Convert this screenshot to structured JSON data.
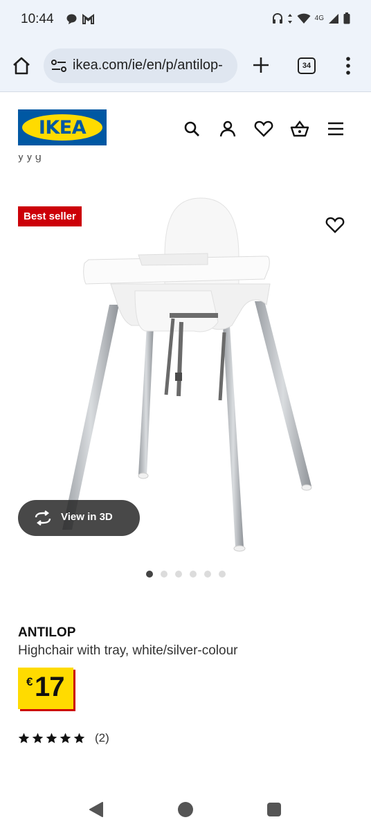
{
  "status_bar": {
    "time": "10:44",
    "network": "4G",
    "left_icons": [
      "chat-icon",
      "gmail-icon"
    ],
    "right_icons": [
      "headset-icon",
      "data-arrows-icon",
      "wifi-icon",
      "signal-icon",
      "battery-icon"
    ]
  },
  "browser": {
    "url": "ikea.com/ie/en/p/antilop-",
    "tab_count": "34",
    "icons": [
      "home-icon",
      "site-settings-icon",
      "new-tab-icon",
      "tabs-icon",
      "menu-icon"
    ]
  },
  "header": {
    "logo_text": "IKEA",
    "nav_icons": [
      "search-icon",
      "account-icon",
      "favourites-icon",
      "basket-icon",
      "hamburger-icon"
    ],
    "cut_text": "y                      y g"
  },
  "product": {
    "badge": "Best seller",
    "view_3d_label": "View in 3D",
    "image_count": 6,
    "active_image": 1,
    "name": "ANTILOP",
    "description": "Highchair with tray, white/silver-colour",
    "price_currency": "€",
    "price_value": "17",
    "rating_stars": 5,
    "rating_count": "(2)"
  },
  "colors": {
    "ikea_blue": "#0058a3",
    "ikea_yellow": "#ffdb00",
    "badge_red": "#cc0008"
  }
}
